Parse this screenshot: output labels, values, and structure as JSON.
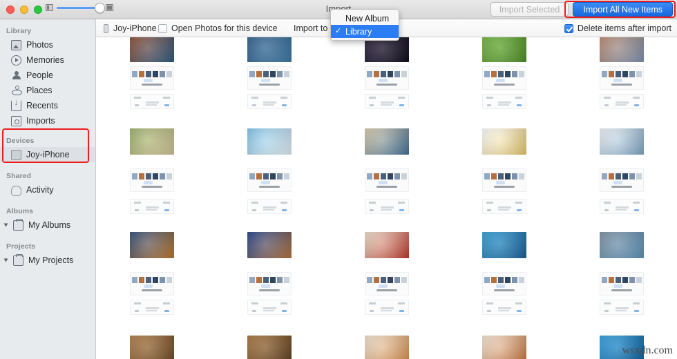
{
  "window": {
    "title": "Import",
    "traffic_lights": [
      "close",
      "minimize",
      "maximize"
    ]
  },
  "zoom_slider": {
    "small_icon": "small-thumbnail-icon",
    "large_icon": "large-thumbnail-icon",
    "value_percent": 88
  },
  "toolbar": {
    "import_selected_label": "Import Selected",
    "import_selected_enabled": false,
    "import_all_label": "Import All New Items",
    "import_all_highlighted": true,
    "accent_blue": "#1867e0",
    "annotation_red": "#ee1c1c"
  },
  "subbar": {
    "device_name": "Joy-iPhone",
    "open_photos_label": "Open Photos for this device",
    "open_photos_checked": false,
    "import_to_label": "Import to",
    "delete_after_label": "Delete items after import",
    "delete_after_checked": true
  },
  "popup_menu": {
    "open": true,
    "items": [
      {
        "label": "New Album",
        "checked": false,
        "selected": false
      },
      {
        "label": "Library",
        "checked": true,
        "selected": true
      }
    ],
    "checkmark": "✓"
  },
  "sidebar": {
    "sections": [
      {
        "header": "Library",
        "items": [
          {
            "label": "Photos",
            "icon": "photos-icon"
          },
          {
            "label": "Memories",
            "icon": "memories-icon"
          },
          {
            "label": "People",
            "icon": "people-icon"
          },
          {
            "label": "Places",
            "icon": "places-icon"
          },
          {
            "label": "Recents",
            "icon": "recents-icon"
          },
          {
            "label": "Imports",
            "icon": "imports-icon"
          }
        ]
      },
      {
        "header": "Devices",
        "items": [
          {
            "label": "Joy-iPhone",
            "icon": "iphone-icon",
            "selected": true
          }
        ]
      },
      {
        "header": "Shared",
        "items": [
          {
            "label": "Activity",
            "icon": "cloud-icon"
          }
        ]
      },
      {
        "header": "Albums",
        "items": [
          {
            "label": "My Albums",
            "icon": "album-icon",
            "disclosure": true
          }
        ]
      },
      {
        "header": "Projects",
        "items": [
          {
            "label": "My Projects",
            "icon": "album-icon",
            "disclosure": true
          }
        ]
      }
    ]
  },
  "grid": {
    "columns": 5,
    "column_centers": [
      220,
      390,
      560,
      730,
      900
    ],
    "row_tops": [
      52,
      96,
      136,
      186,
      244,
      288,
      336,
      394,
      434,
      486
    ],
    "items": [
      {
        "row": 0,
        "col": 0,
        "kind": "photo",
        "c1": "#8d4a2c",
        "c2": "#2d5c87"
      },
      {
        "row": 0,
        "col": 1,
        "kind": "photo",
        "c1": "#2d5a86",
        "c2": "#3e7ba8"
      },
      {
        "row": 0,
        "col": 2,
        "kind": "photo",
        "c1": "#2a1f3d",
        "c2": "#0d0b18"
      },
      {
        "row": 0,
        "col": 3,
        "kind": "photo",
        "c1": "#6fb23a",
        "c2": "#4e8f27"
      },
      {
        "row": 0,
        "col": 4,
        "kind": "photo",
        "c1": "#b9876a",
        "c2": "#7e95b4"
      },
      {
        "row": 1,
        "col": 0,
        "kind": "sshot"
      },
      {
        "row": 1,
        "col": 1,
        "kind": "sshot"
      },
      {
        "row": 1,
        "col": 2,
        "kind": "sshot"
      },
      {
        "row": 1,
        "col": 3,
        "kind": "sshot"
      },
      {
        "row": 1,
        "col": 4,
        "kind": "sshot"
      },
      {
        "row": 2,
        "col": 0,
        "kind": "card"
      },
      {
        "row": 2,
        "col": 1,
        "kind": "card"
      },
      {
        "row": 2,
        "col": 2,
        "kind": "card"
      },
      {
        "row": 2,
        "col": 3,
        "kind": "card"
      },
      {
        "row": 2,
        "col": 4,
        "kind": "card"
      },
      {
        "row": 3,
        "col": 0,
        "kind": "photo",
        "c1": "#9ab06a",
        "c2": "#d6c79a"
      },
      {
        "row": 3,
        "col": 1,
        "kind": "photo",
        "c1": "#7fc2e8",
        "c2": "#e9f2f7"
      },
      {
        "row": 3,
        "col": 2,
        "kind": "photo",
        "c1": "#d9c9a8",
        "c2": "#41729c"
      },
      {
        "row": 3,
        "col": 3,
        "kind": "photo",
        "c1": "#ffffff",
        "c2": "#e8c96a"
      },
      {
        "row": 3,
        "col": 4,
        "kind": "photo",
        "c1": "#eef3f7",
        "c2": "#7fa8c7"
      },
      {
        "row": 4,
        "col": 0,
        "kind": "sshot"
      },
      {
        "row": 4,
        "col": 1,
        "kind": "sshot"
      },
      {
        "row": 4,
        "col": 2,
        "kind": "sshot"
      },
      {
        "row": 4,
        "col": 3,
        "kind": "sshot"
      },
      {
        "row": 4,
        "col": 4,
        "kind": "sshot"
      },
      {
        "row": 5,
        "col": 0,
        "kind": "card"
      },
      {
        "row": 5,
        "col": 1,
        "kind": "card"
      },
      {
        "row": 5,
        "col": 2,
        "kind": "card"
      },
      {
        "row": 5,
        "col": 3,
        "kind": "card"
      },
      {
        "row": 5,
        "col": 4,
        "kind": "card"
      },
      {
        "row": 6,
        "col": 0,
        "kind": "photo",
        "c1": "#2b4a7a",
        "c2": "#c07a2e"
      },
      {
        "row": 6,
        "col": 1,
        "kind": "photo",
        "c1": "#1e3f8c",
        "c2": "#b5763c"
      },
      {
        "row": 6,
        "col": 2,
        "kind": "photo",
        "c1": "#ece0cc",
        "c2": "#c0392b"
      },
      {
        "row": 6,
        "col": 3,
        "kind": "photo",
        "c1": "#2e9fd6",
        "c2": "#1b5f99"
      },
      {
        "row": 6,
        "col": 4,
        "kind": "photo",
        "c1": "#7d8fa0",
        "c2": "#5d96be"
      },
      {
        "row": 7,
        "col": 0,
        "kind": "sshot"
      },
      {
        "row": 7,
        "col": 1,
        "kind": "sshot"
      },
      {
        "row": 7,
        "col": 2,
        "kind": "sshot"
      },
      {
        "row": 7,
        "col": 3,
        "kind": "sshot"
      },
      {
        "row": 7,
        "col": 4,
        "kind": "sshot"
      },
      {
        "row": 8,
        "col": 0,
        "kind": "card"
      },
      {
        "row": 8,
        "col": 1,
        "kind": "card"
      },
      {
        "row": 8,
        "col": 2,
        "kind": "card"
      },
      {
        "row": 8,
        "col": 3,
        "kind": "card"
      },
      {
        "row": 8,
        "col": 4,
        "kind": "card"
      },
      {
        "row": 9,
        "col": 0,
        "kind": "photo",
        "c1": "#b07a42",
        "c2": "#6d4a24"
      },
      {
        "row": 9,
        "col": 1,
        "kind": "photo",
        "c1": "#a8743c",
        "c2": "#5e4020"
      },
      {
        "row": 9,
        "col": 2,
        "kind": "photo",
        "c1": "#f0e2d2",
        "c2": "#d88f4a"
      },
      {
        "row": 9,
        "col": 3,
        "kind": "photo",
        "c1": "#f4e6d6",
        "c2": "#c9753a"
      },
      {
        "row": 9,
        "col": 4,
        "kind": "photo",
        "c1": "#2f9fe0",
        "c2": "#0d5f9c"
      }
    ]
  },
  "watermark": {
    "text": "wsxdn.com"
  }
}
